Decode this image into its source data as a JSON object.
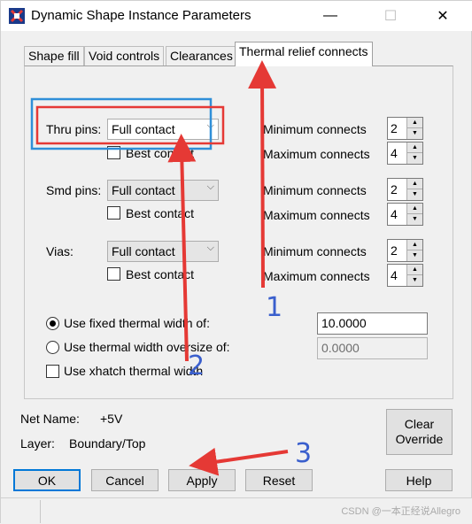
{
  "window": {
    "title": "Dynamic Shape Instance Parameters",
    "controls": {
      "minimize": "—",
      "maximize": "☐",
      "close": "✕"
    }
  },
  "tabs": [
    {
      "label": "Shape fill"
    },
    {
      "label": "Void controls"
    },
    {
      "label": "Clearances"
    },
    {
      "label": "Thermal relief connects"
    }
  ],
  "thru_pins": {
    "label": "Thru pins:",
    "value": "Full contact",
    "best_contact": "Best contact",
    "min_label": "Minimum connects",
    "min_value": "2",
    "max_label": "Maximum connects",
    "max_value": "4"
  },
  "smd_pins": {
    "label": "Smd pins:",
    "value": "Full contact",
    "best_contact": "Best contact",
    "min_label": "Minimum connects",
    "min_value": "2",
    "max_label": "Maximum connects",
    "max_value": "4"
  },
  "vias": {
    "label": "Vias:",
    "value": "Full contact",
    "best_contact": "Best contact",
    "min_label": "Minimum connects",
    "min_value": "2",
    "max_label": "Maximum connects",
    "max_value": "4"
  },
  "thermal_width": {
    "fixed_label": "Use fixed thermal width of:",
    "fixed_value": "10.0000",
    "oversize_label": "Use thermal width oversize of:",
    "oversize_value": "0.0000",
    "xhatch_label": "Use xhatch thermal width"
  },
  "info": {
    "net_name_label": "Net Name:",
    "net_name_value": "+5V",
    "layer_label": "Layer:",
    "layer_value": "Boundary/Top"
  },
  "buttons": {
    "clear_override_1": "Clear",
    "clear_override_2": "Override",
    "ok": "OK",
    "cancel": "Cancel",
    "apply": "Apply",
    "reset": "Reset",
    "help": "Help"
  },
  "annotations": {
    "n1": "1",
    "n2": "2",
    "n3": "3",
    "color_red": "#e53935",
    "color_blue": "#2f8fd8",
    "color_number": "#3a5fcd"
  },
  "watermark": "CSDN @一本正经说Allegro"
}
